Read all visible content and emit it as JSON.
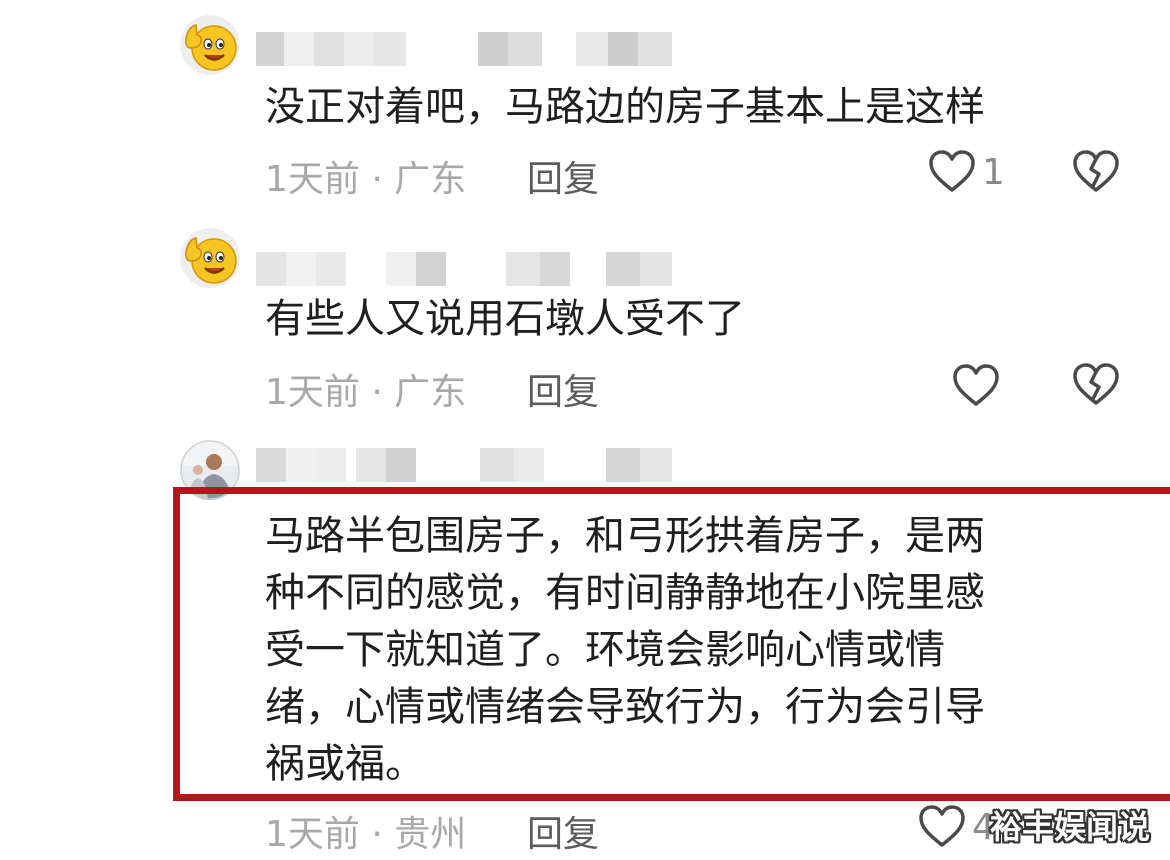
{
  "comments": [
    {
      "avatar": "thumbs-up-emoji-avatar",
      "text": "没正对着吧，马路边的房子基本上是这样",
      "time": "1天前",
      "location": "广东",
      "reply_label": "回复",
      "likes": "1"
    },
    {
      "avatar": "thumbs-up-emoji-avatar",
      "text": "有些人又说用石墩人受不了",
      "time": "1天前",
      "location": "广东",
      "reply_label": "回复",
      "likes": ""
    },
    {
      "avatar": "photo-avatar",
      "text_lines": [
        "马路半包围房子，和弓形拱着房子，是两",
        "种不同的感觉，有时间静静地在小院里感",
        "受一下就知道了。环境会影响心情或情",
        "绪，心情或情绪会导致行为，行为会引导",
        "祸或福。"
      ],
      "time": "1天前",
      "location": "贵州",
      "reply_label": "回复",
      "likes": "4"
    }
  ],
  "meta_separator": " · ",
  "icons": {
    "like": "heart-outline-icon",
    "dislike": "broken-heart-icon"
  },
  "colors": {
    "highlight_border": "#b3161b",
    "meta_text": "#a8a8a8",
    "body_text": "#1f1f1f"
  },
  "watermark": "裕丰娱闻说"
}
